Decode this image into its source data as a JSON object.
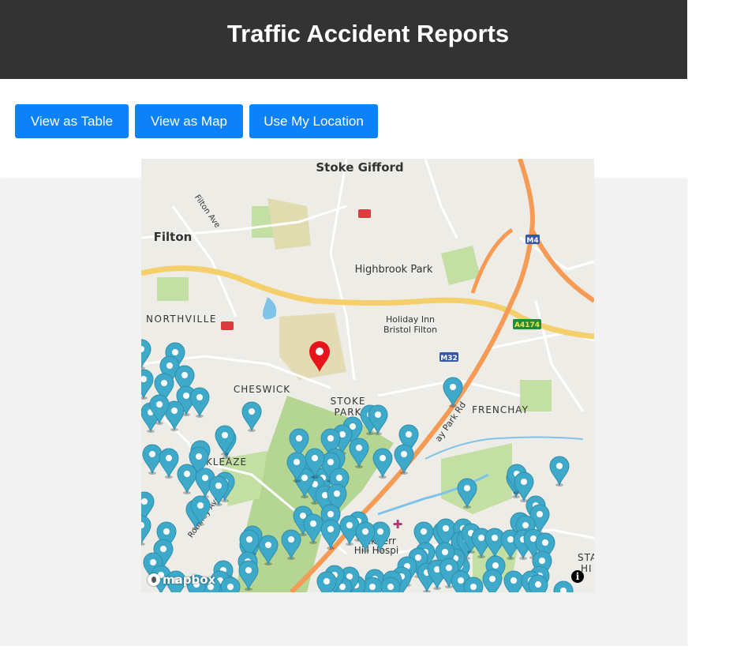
{
  "header": {
    "title": "Traffic Accident Reports"
  },
  "toolbar": {
    "view_table": "View as Table",
    "view_map": "View as Map",
    "use_location": "Use My Location"
  },
  "map": {
    "labels": {
      "stoke_gifford": "Stoke Gifford",
      "filton": "Filton",
      "filton_ave": "Filton Ave",
      "highbrook_park": "Highbrook Park",
      "northville": "NORTHVILLE",
      "holiday_inn_1": "Holiday Inn",
      "holiday_inn_2": "Bristol Filton",
      "cheswick": "CHESWICK",
      "stoke": "STOKE",
      "park": "PARK",
      "frenchay": "FRENCHAY",
      "coldharbour": "KLEAZE",
      "hill_hospital": "Hill Hospi",
      "blackberry": "ackberr",
      "romney_ave": "Romney Ave",
      "frenchay_park_rd": "ay Park Rd",
      "m4": "M4",
      "a4174": "A4174",
      "m32": "M32",
      "sta": "STA",
      "hi": "HI"
    },
    "attribution": "mapbox",
    "info": "i",
    "colors": {
      "marker": "#3fa9c9",
      "location_marker": "#e8141b"
    }
  }
}
